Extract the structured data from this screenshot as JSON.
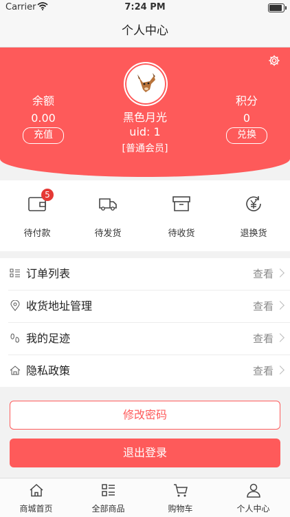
{
  "status_bar": {
    "carrier": "Carrier",
    "time": "7:24 PM",
    "battery_level": 0.9
  },
  "navbar": {
    "title": "个人中心"
  },
  "profile": {
    "balance_label": "余额",
    "balance_value": "0.00",
    "recharge_label": "充值",
    "points_label": "积分",
    "points_value": "0",
    "exchange_label": "兑换",
    "nickname": "黑色月光",
    "uid": "uid: 1",
    "member_level": "[普通会员]"
  },
  "orders": [
    {
      "label": "待付款",
      "icon": "wallet-icon",
      "badge": "5"
    },
    {
      "label": "待发货",
      "icon": "truck-icon"
    },
    {
      "label": "待收货",
      "icon": "box-icon"
    },
    {
      "label": "退换货",
      "icon": "yuan-refund-icon"
    }
  ],
  "menu": [
    {
      "label": "订单列表",
      "icon": "list-icon",
      "action": "查看"
    },
    {
      "label": "收货地址管理",
      "icon": "location-icon",
      "action": "查看"
    },
    {
      "label": "我的足迹",
      "icon": "footprint-icon",
      "action": "查看"
    },
    {
      "label": "隐私政策",
      "icon": "home-icon",
      "action": "查看"
    }
  ],
  "buttons": {
    "change_password": "修改密码",
    "logout": "退出登录"
  },
  "tabs": [
    {
      "label": "商城首页",
      "icon": "home-icon"
    },
    {
      "label": "全部商品",
      "icon": "category-icon"
    },
    {
      "label": "购物车",
      "icon": "cart-icon"
    },
    {
      "label": "个人中心",
      "icon": "user-icon"
    }
  ],
  "colors": {
    "accent": "#fe5a5a",
    "badge": "#e53935"
  }
}
